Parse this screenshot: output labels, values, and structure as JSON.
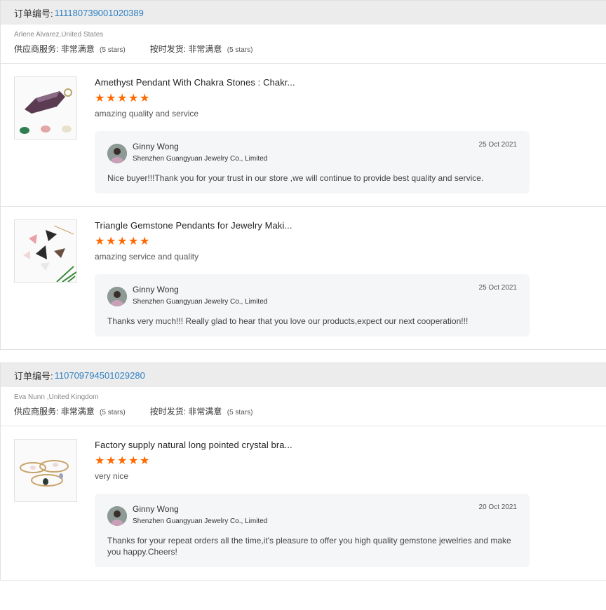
{
  "order_label": "订单编号:",
  "stars_count": 5,
  "orders": [
    {
      "order_number": "111180739001020389",
      "buyer": "Arlene Alvarez,United States",
      "ratings": [
        {
          "label": "供应商服务:",
          "value": "非常满意",
          "stars": "(5 stars)"
        },
        {
          "label": "按时发货:",
          "value": "非常满意",
          "stars": "(5 stars)"
        }
      ],
      "items": [
        {
          "title": "Amethyst Pendant With Chakra Stones : Chakr...",
          "rating": 5,
          "comment": "amazing quality and service",
          "reply": {
            "name": "Ginny Wong",
            "company": "Shenzhen Guangyuan Jewelry Co., Limited",
            "date": "25 Oct 2021",
            "text": "Nice buyer!!!Thank you for your trust in our store ,we will continue to provide best quality and service."
          }
        },
        {
          "title": "Triangle Gemstone Pendants for Jewelry Maki...",
          "rating": 5,
          "comment": "amazing service and quality",
          "reply": {
            "name": "Ginny Wong",
            "company": "Shenzhen Guangyuan Jewelry Co., Limited",
            "date": "25 Oct 2021",
            "text": "Thanks very much!!! Really glad to hear that you love our products,expect our next cooperation!!!"
          }
        }
      ]
    },
    {
      "order_number": "110709794501029280",
      "buyer": "Eva Nunn ,United Kingdom",
      "ratings": [
        {
          "label": "供应商服务:",
          "value": "非常满意",
          "stars": "(5 stars)"
        },
        {
          "label": "按时发货:",
          "value": "非常满意",
          "stars": "(5 stars)"
        }
      ],
      "items": [
        {
          "title": "Factory supply natural long pointed crystal bra...",
          "rating": 5,
          "comment": "very nice",
          "reply": {
            "name": "Ginny Wong",
            "company": "Shenzhen Guangyuan Jewelry Co., Limited",
            "date": "20 Oct 2021",
            "text": "Thanks for your repeat orders all the time,it's pleasure to offer you high quality gemstone jewelries and make you happy.Cheers!"
          }
        }
      ]
    }
  ],
  "colors": {
    "star": "#ff6a00",
    "order_number": "#2d7fc1",
    "header_bg": "#ececec",
    "reply_bg": "#f5f6f7"
  }
}
